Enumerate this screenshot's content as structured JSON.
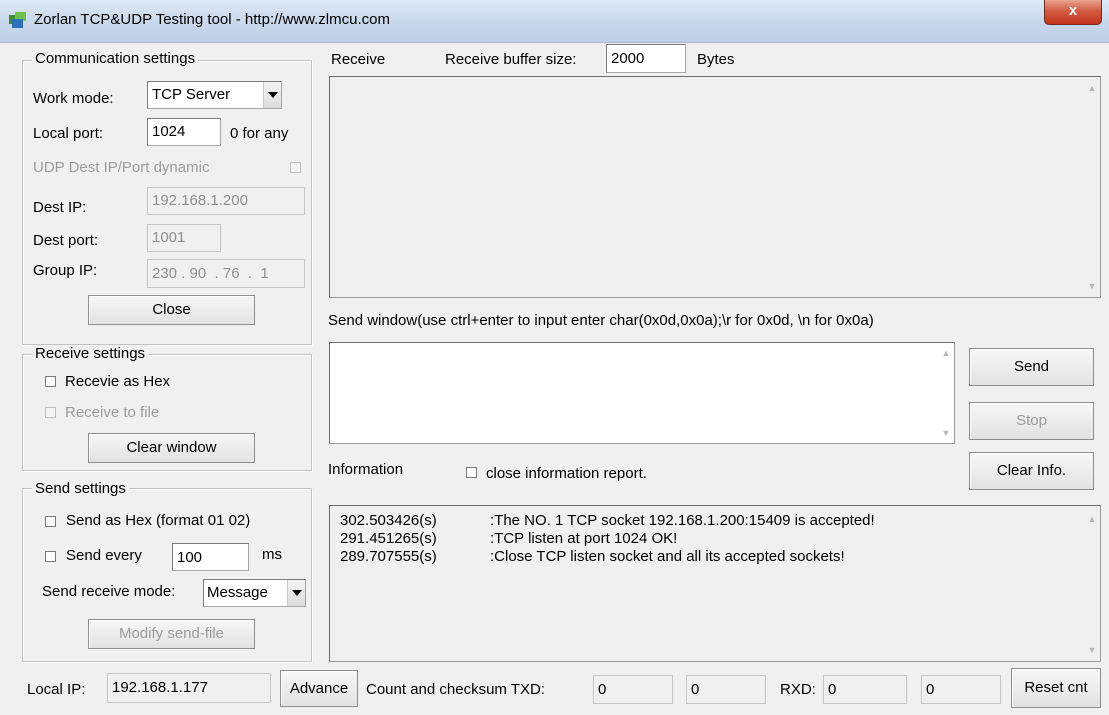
{
  "window": {
    "title": "Zorlan TCP&UDP Testing tool - http://www.zlmcu.com",
    "close_glyph": "x"
  },
  "comm": {
    "legend": "Communication settings",
    "work_mode_label": "Work mode:",
    "work_mode_value": "TCP Server",
    "local_port_label": "Local port:",
    "local_port_value": "1024",
    "any_hint": "0 for any",
    "udp_dynamic_label": "UDP Dest IP/Port dynamic",
    "dest_ip_label": "Dest IP:",
    "dest_ip_value": "192.168.1.200",
    "dest_port_label": "Dest port:",
    "dest_port_value": "1001",
    "group_ip_label": "Group IP:",
    "group_ip_value": "230 . 90  . 76  .  1",
    "close_button": "Close"
  },
  "receive_settings": {
    "legend": "Receive settings",
    "hex_label": "Recevie as Hex",
    "file_label": "Receive to file",
    "clear_button": "Clear window"
  },
  "send_settings": {
    "legend": "Send settings",
    "hex_label": "Send as Hex (format 01 02)",
    "every_label": "Send every",
    "every_value": "100",
    "every_unit": "ms",
    "mode_label": "Send receive mode:",
    "mode_value": "Message",
    "modify_button": "Modify send-file"
  },
  "receive": {
    "label": "Receive",
    "buffer_label": "Receive buffer size:",
    "buffer_value": "2000",
    "buffer_unit": "Bytes"
  },
  "send_window": {
    "label": "Send window(use ctrl+enter to input enter char(0x0d,0x0a);\\r for 0x0d, \\n for 0x0a)",
    "send_button": "Send",
    "stop_button": "Stop"
  },
  "info": {
    "label": "Information",
    "close_report_label": "close information report.",
    "clear_button": "Clear Info.",
    "log": [
      {
        "time": "302.503426(s)",
        "message": ":The NO. 1 TCP socket 192.168.1.200:15409 is accepted!"
      },
      {
        "time": "291.451265(s)",
        "message": ":TCP listen at port 1024 OK!"
      },
      {
        "time": "289.707555(s)",
        "message": ":Close TCP listen socket and all its accepted sockets!"
      }
    ]
  },
  "status": {
    "local_ip_label": "Local IP:",
    "local_ip_value": "192.168.1.177",
    "advance_button": "Advance",
    "count_label": "Count and checksum TXD:",
    "txd_count": "0",
    "txd_checksum": "0",
    "rxd_label": "RXD:",
    "rxd_count": "0",
    "rxd_checksum": "0",
    "reset_button": "Reset cnt"
  }
}
